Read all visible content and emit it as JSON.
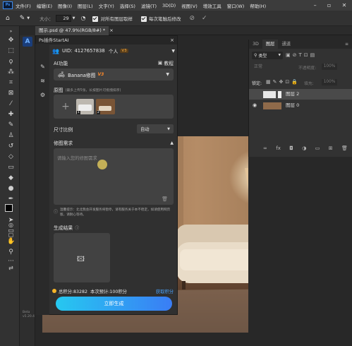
{
  "menubar": {
    "items": [
      "文件(F)",
      "编辑(E)",
      "图像(I)",
      "图层(L)",
      "文字(Y)",
      "选择(S)",
      "滤镜(T)",
      "3D(D)",
      "视图(V)",
      "增效工具",
      "窗口(W)",
      "帮助(H)"
    ],
    "logo": "Ps"
  },
  "options": {
    "size_label": "大小：",
    "size_value": "29",
    "sample_all": "对所有图层取样",
    "auto_enhance": "每次笔触后修改"
  },
  "document_tab": {
    "title": "图示.psd @ 47.9%(RGB/8#) *",
    "close": "×"
  },
  "plugin": {
    "title": "Ps插件StartAI",
    "close": "×",
    "uid_label": "UID:",
    "uid_value": "4127657838",
    "account_type": "个人",
    "badge": "V3",
    "ai_function_label": "AI功能",
    "tutorial": "教程",
    "model_name": "Banana修图",
    "model_badge": "V3",
    "source_section": "原图",
    "source_hint": "(最多上传5张，长按图片可拖拽排序)",
    "thumb1_num": "1",
    "thumb2_num": "2",
    "ratio_label": "尺寸比例",
    "ratio_value": "自动",
    "requirement_label": "修图需求",
    "requirement_placeholder": "请输入您的修图需求",
    "warning": "温馨提示：北北我会开发服务将暂停，请有服务关于本不稳定，如请使用网页版，请耐心等待。",
    "result_label": "生成结果",
    "points_total": "总积分:83282",
    "points_cost": "本次预计:100积分",
    "get_points": "获取积分",
    "generate": "立即生成",
    "version_1": "Beta",
    "version_2": "v5.20.4"
  },
  "layers": {
    "tabs": [
      "3D",
      "图层",
      "通道"
    ],
    "kind": "类型",
    "blend": "正常",
    "opacity_label": "不透明度:",
    "opacity_value": "100%",
    "lock_label": "锁定:",
    "fill_label": "填充:",
    "fill_value": "100%",
    "layer_names": [
      "图层 2",
      "图层 0"
    ]
  }
}
